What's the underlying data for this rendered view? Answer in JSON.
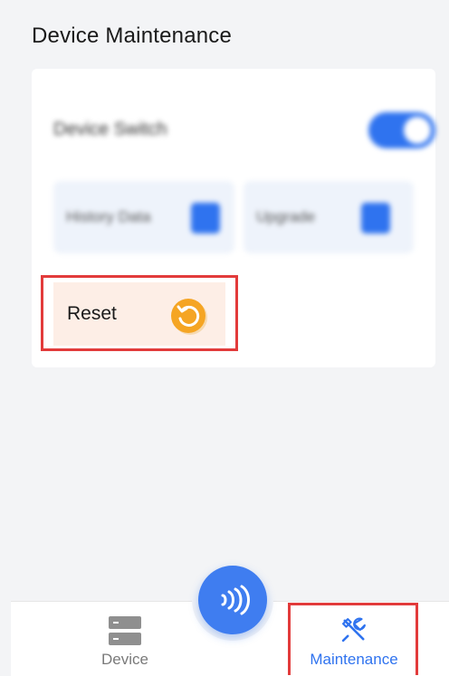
{
  "page": {
    "title": "Device Maintenance"
  },
  "card": {
    "switch_label": "Device Switch",
    "switch_on": true,
    "history_label": "History Data",
    "upgrade_label": "Upgrade",
    "reset_label": "Reset"
  },
  "nav": {
    "device_label": "Device",
    "maintenance_label": "Maintenance",
    "fab_icon": "nfc-icon",
    "active": "Maintenance"
  },
  "colors": {
    "accent": "#2f73ef",
    "reset_bg": "#fdeee6",
    "reset_icon": "#f5a524",
    "highlight": "#e23b3b"
  }
}
